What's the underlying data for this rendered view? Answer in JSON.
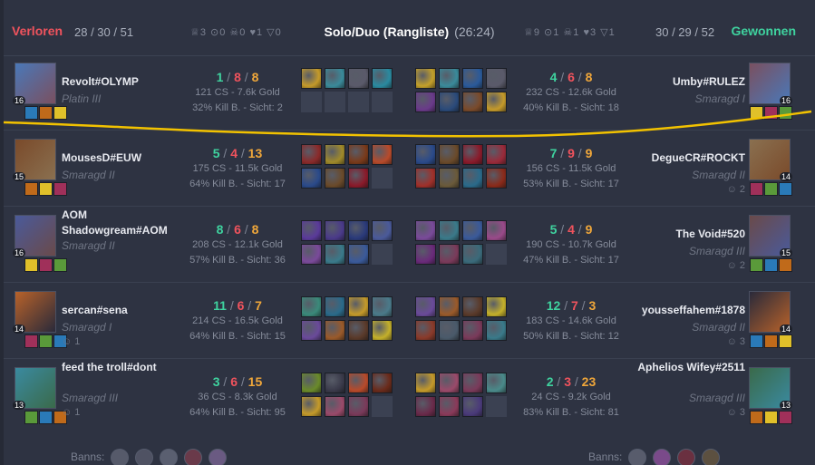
{
  "header": {
    "left_result": "Verloren",
    "left_kda": "28 / 30 / 51",
    "left_objectives": "♕3 ⊙0 ☠0 ♥1 ▽0",
    "mode": "Solo/Duo (Rangliste)",
    "duration": "(26:24)",
    "right_objectives": "♕9 ⊙1 ☠1 ♥3 ▽1",
    "right_kda": "30 / 29 / 52",
    "right_result": "Gewonnen"
  },
  "rows": [
    {
      "left": {
        "name": "Revolt#OLYMP",
        "rank": "Platin III",
        "party": "",
        "level": "16",
        "k": "1",
        "d": "8",
        "a": "8",
        "cs_gold": "121 CS - 7.6k Gold",
        "kill_vision": "32% Kill B. - Sicht: 2"
      },
      "right": {
        "name": "Umby#RULEZ",
        "rank": "Smaragd I",
        "party": "",
        "level": "16",
        "k": "4",
        "d": "6",
        "a": "8",
        "cs_gold": "232 CS - 12.6k Gold",
        "kill_vision": "40% Kill B. - Sicht: 18"
      }
    },
    {
      "left": {
        "name": "MousesD#EUW",
        "rank": "Smaragd II",
        "party": "",
        "level": "15",
        "k": "5",
        "d": "4",
        "a": "13",
        "cs_gold": "175 CS - 11.5k Gold",
        "kill_vision": "64% Kill B. - Sicht: 17"
      },
      "right": {
        "name": "DegueCR#ROCKT",
        "rank": "Smaragd II",
        "party": "2",
        "level": "14",
        "k": "7",
        "d": "9",
        "a": "9",
        "cs_gold": "156 CS - 11.5k Gold",
        "kill_vision": "53% Kill B. - Sicht: 17"
      }
    },
    {
      "left": {
        "name": "AOM Shadowgream#AOM",
        "rank": "Smaragd II",
        "party": "",
        "level": "16",
        "k": "8",
        "d": "6",
        "a": "8",
        "cs_gold": "208 CS - 12.1k Gold",
        "kill_vision": "57% Kill B. - Sicht: 36"
      },
      "right": {
        "name": "The Void#520",
        "rank": "Smaragd III",
        "party": "2",
        "level": "15",
        "k": "5",
        "d": "4",
        "a": "9",
        "cs_gold": "190 CS - 10.7k Gold",
        "kill_vision": "47% Kill B. - Sicht: 17"
      }
    },
    {
      "left": {
        "name": "sercan#sena",
        "rank": "Smaragd I",
        "party": "1",
        "level": "14",
        "k": "11",
        "d": "6",
        "a": "7",
        "cs_gold": "214 CS - 16.5k Gold",
        "kill_vision": "64% Kill B. - Sicht: 15"
      },
      "right": {
        "name": "yousseffahem#1878",
        "rank": "Smaragd II",
        "party": "3",
        "level": "14",
        "k": "12",
        "d": "7",
        "a": "3",
        "cs_gold": "183 CS - 14.6k Gold",
        "kill_vision": "50% Kill B. - Sicht: 12"
      }
    },
    {
      "left": {
        "name": "feed the troll#dont",
        "rank": "Smaragd III",
        "party": "1",
        "level": "13",
        "k": "3",
        "d": "6",
        "a": "15",
        "cs_gold": "36 CS - 8.3k Gold",
        "kill_vision": "64% Kill B. - Sicht: 95"
      },
      "right": {
        "name": "Aphelios Wifey#2511",
        "rank": "Smaragd III",
        "party": "3",
        "level": "13",
        "k": "2",
        "d": "3",
        "a": "23",
        "cs_gold": "24 CS - 9.2k Gold",
        "kill_vision": "83% Kill B. - Sicht: 81"
      }
    }
  ],
  "bans_label": "Banns:",
  "colors": {
    "loss": "#f0535d",
    "win": "#3fd39f",
    "assist": "#f0a73a",
    "highlight_line": "#f2c200"
  }
}
